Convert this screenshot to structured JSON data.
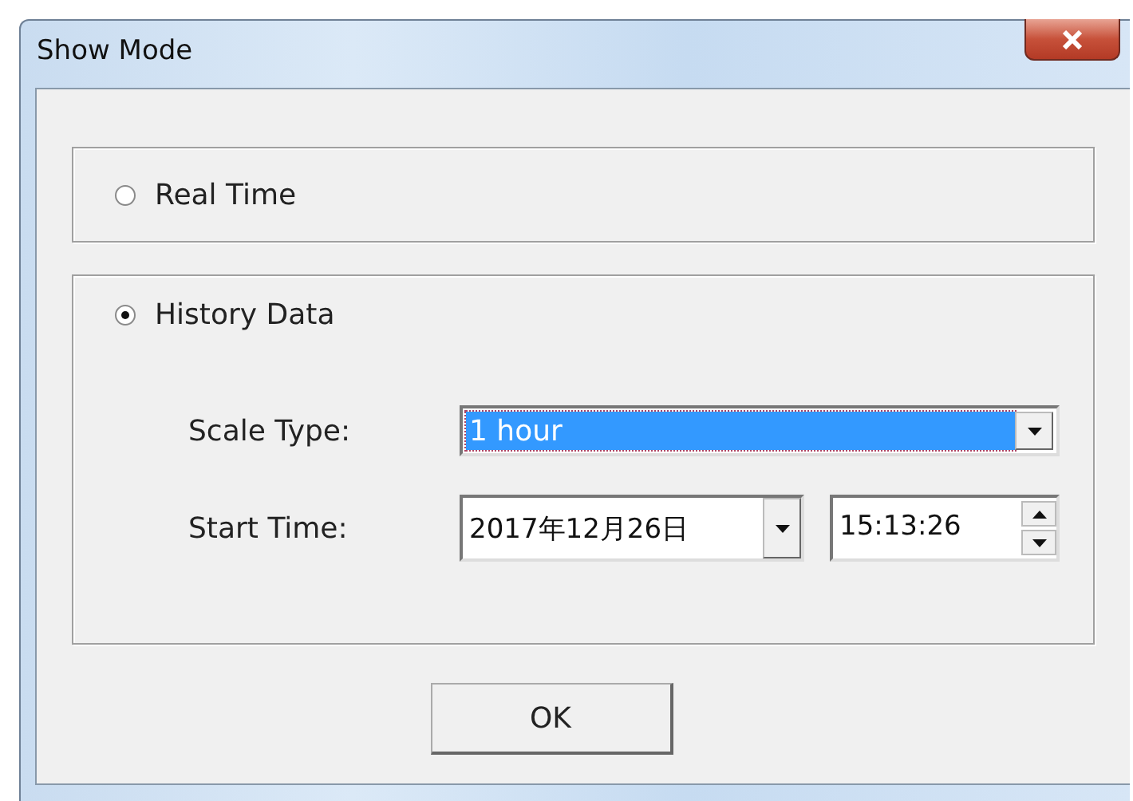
{
  "window": {
    "title": "Show Mode"
  },
  "modes": [
    {
      "label": "Real Time",
      "selected": false
    },
    {
      "label": "History Data",
      "selected": true
    }
  ],
  "scale_type": {
    "label": "Scale Type:",
    "value": "1 hour"
  },
  "start_time": {
    "label": "Start Time:",
    "date": "2017年12月26日",
    "time": "15:13:26"
  },
  "buttons": [
    "OK"
  ]
}
